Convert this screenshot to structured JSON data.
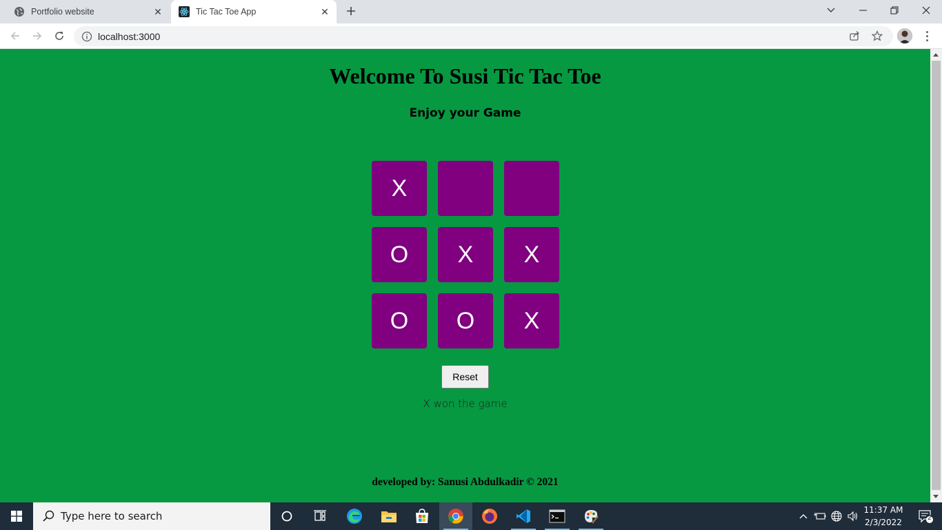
{
  "browser": {
    "tabs": [
      {
        "title": "Portfolio website",
        "active": false
      },
      {
        "title": "Tic Tac Toe App",
        "active": true
      }
    ],
    "url": "localhost:3000"
  },
  "page": {
    "title": "Welcome To Susi Tic Tac Toe",
    "subtitle": "Enjoy your Game",
    "board": [
      "X",
      "",
      "",
      "O",
      "X",
      "X",
      "O",
      "O",
      "X"
    ],
    "reset_label": "Reset",
    "status": "X won the game",
    "footer": "developed by: Sanusi Abdulkadir © 2021"
  },
  "taskbar": {
    "search_placeholder": "Type here to search",
    "time": "11:37 AM",
    "date": "2/3/2022",
    "notification_count": "2"
  },
  "colors": {
    "page_bg": "#069942",
    "cell_bg": "#800080",
    "taskbar_bg": "#1f2c39"
  }
}
